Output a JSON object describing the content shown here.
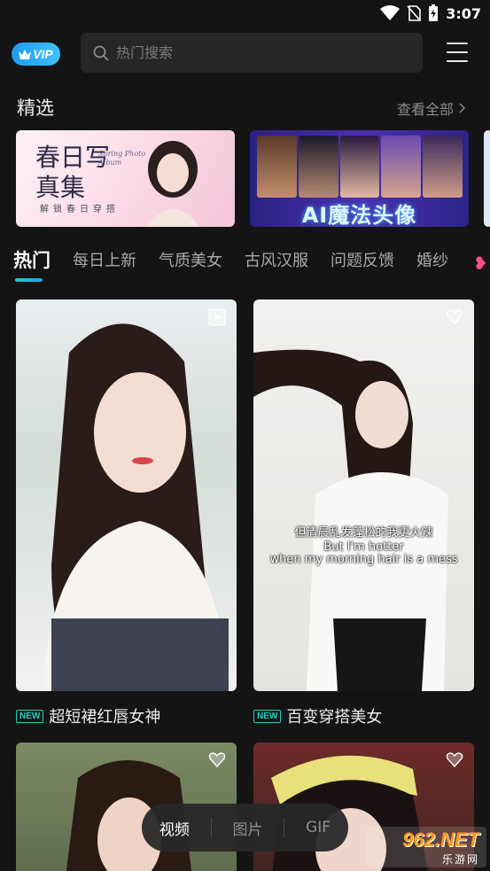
{
  "status_bar": {
    "time": "3:07"
  },
  "header": {
    "vip_label": "VIP",
    "search_placeholder": "热门搜索"
  },
  "featured": {
    "title": "精选",
    "view_all": "查看全部",
    "banners": [
      {
        "title": "春日写真集",
        "english": "Spring Photo Album",
        "subtitle": "解锁春日穿搭"
      },
      {
        "title": "AI魔法头像"
      }
    ]
  },
  "tabs": [
    "热门",
    "每日上新",
    "气质美女",
    "古风汉服",
    "问题反馈",
    "婚纱"
  ],
  "active_tab": "热门",
  "cards": [
    {
      "tag": "NEW",
      "title": "超短裙红唇女神"
    },
    {
      "tag": "NEW",
      "title": "百变穿搭美女",
      "subtitles": [
        "但清晨乱发蓬松的我更火辣",
        "But I'm hotter",
        "when my morning hair is a mess"
      ]
    }
  ],
  "media_switch": {
    "items": [
      "视频",
      "图片",
      "GIF"
    ],
    "active": "视频"
  },
  "watermark": {
    "main": "962.NET",
    "sub": "乐游网"
  },
  "colors": {
    "accent": "#1fa3ee",
    "new_tag": "#22cfc1",
    "background": "#141414"
  }
}
